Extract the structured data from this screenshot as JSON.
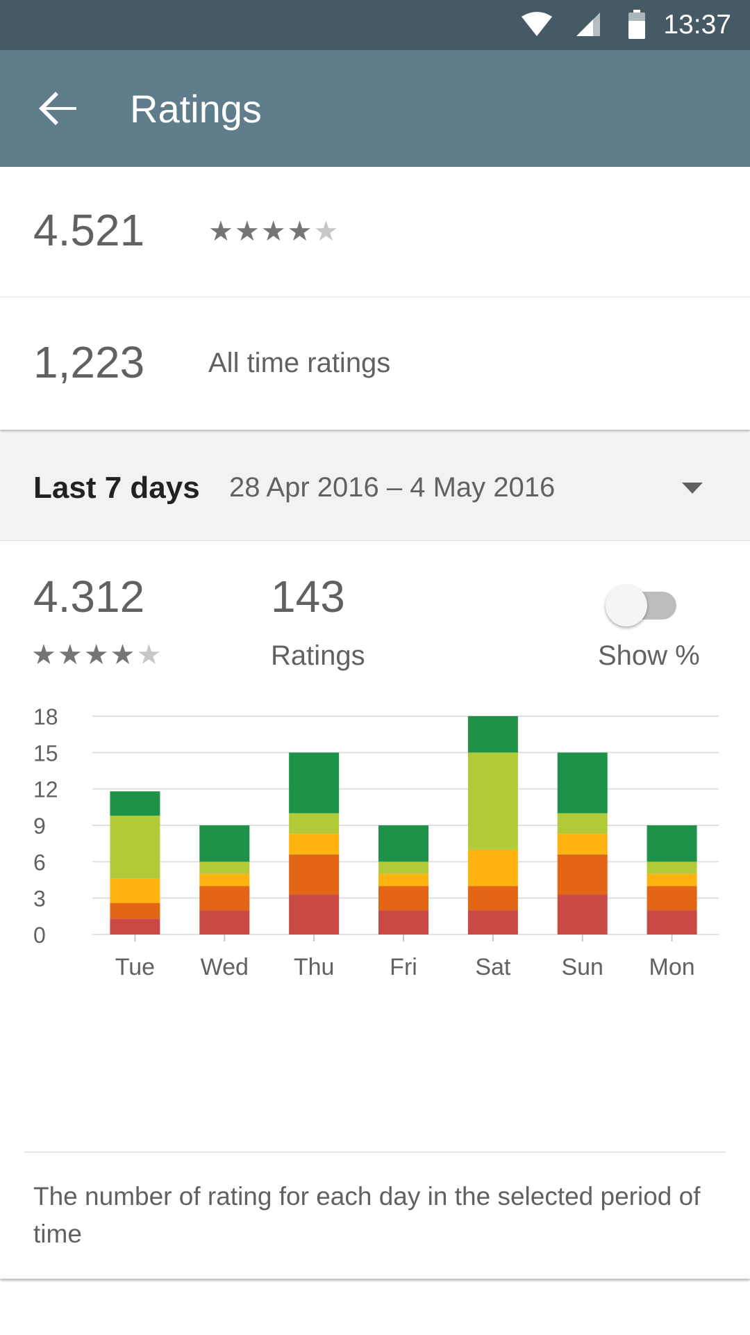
{
  "status_bar": {
    "time": "13:37",
    "icons": [
      "wifi-icon",
      "cell-signal-icon",
      "battery-icon"
    ]
  },
  "app_bar": {
    "title": "Ratings",
    "back_icon": "arrow-back-icon"
  },
  "overall": {
    "average": "4.521",
    "stars": 4,
    "stars_max": 5
  },
  "total": {
    "count": "1,223",
    "label": "All time ratings"
  },
  "period": {
    "label": "Last 7 days",
    "range": "28 Apr 2016  – 4 May 2016",
    "dropdown_icon": "dropdown-arrow-icon"
  },
  "period_stats": {
    "average": "4.312",
    "stars": 4,
    "stars_max": 5,
    "count": "143",
    "count_label": "Ratings",
    "toggle_label": "Show %",
    "toggle_on": false
  },
  "description": "The number of rating for each day in the selected period of time",
  "colors": {
    "status_bar": "#455a64",
    "app_bar": "#607d8b",
    "one_star": "#c94a44",
    "two_star": "#e36516",
    "three_star": "#ffb311",
    "four_star": "#b2ca37",
    "five_star": "#1d9248"
  },
  "chart_data": {
    "type": "bar",
    "stacked": true,
    "categories": [
      "Tue",
      "Wed",
      "Thu",
      "Fri",
      "Sat",
      "Sun",
      "Mon"
    ],
    "series": [
      {
        "values": [
          1.3,
          2,
          3.3,
          2,
          2,
          3.3,
          2
        ],
        "color": "#c94a44"
      },
      {
        "values": [
          1.3,
          2,
          3.3,
          2,
          2,
          3.3,
          2
        ],
        "color": "#e36516"
      },
      {
        "values": [
          2,
          1,
          1.7,
          1,
          3,
          1.7,
          1
        ],
        "color": "#ffb311"
      },
      {
        "values": [
          5.2,
          1,
          1.7,
          1,
          8,
          1.7,
          1
        ],
        "color": "#b2ca37"
      },
      {
        "values": [
          2,
          3,
          5,
          3,
          3,
          5,
          3
        ],
        "color": "#1d9248"
      }
    ],
    "yticks": [
      0,
      3,
      6,
      9,
      12,
      15,
      18
    ],
    "ylim": [
      0,
      18
    ],
    "grid": true
  }
}
